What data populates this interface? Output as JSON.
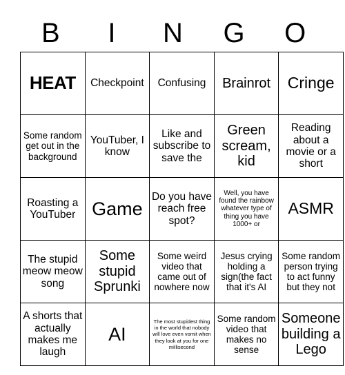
{
  "header": {
    "letters": [
      "B",
      "I",
      "N",
      "G",
      "O"
    ]
  },
  "grid": {
    "rows": [
      [
        {
          "text": "HEAT",
          "size": "bold-heat"
        },
        {
          "text": "Checkpoint",
          "size": "fs-md"
        },
        {
          "text": "Confusing",
          "size": "fs-md"
        },
        {
          "text": "Brainrot",
          "size": "fs-lg"
        },
        {
          "text": "Cringe",
          "size": "fs-xl"
        }
      ],
      [
        {
          "text": "Some random get out in the background",
          "size": "fs-sm"
        },
        {
          "text": "YouTuber, I know",
          "size": "fs-md"
        },
        {
          "text": "Like and subscribe to save the",
          "size": "fs-md"
        },
        {
          "text": "Green scream, kid",
          "size": "fs-lg"
        },
        {
          "text": "Reading about a movie or a short",
          "size": "fs-md"
        }
      ],
      [
        {
          "text": "Roasting a YouTuber",
          "size": "fs-md"
        },
        {
          "text": "Game",
          "size": "fs-xxl"
        },
        {
          "text": "Do you have reach free spot?",
          "size": "fs-md"
        },
        {
          "text": "Well, you have found the rainbow whatever type of thing you have 1000+ or",
          "size": "fs-xs"
        },
        {
          "text": "ASMR",
          "size": "fs-xl"
        }
      ],
      [
        {
          "text": "The stupid meow meow song",
          "size": "fs-md"
        },
        {
          "text": "Some stupid Sprunki",
          "size": "fs-lg"
        },
        {
          "text": "Some weird video that came out of nowhere now",
          "size": "fs-sm"
        },
        {
          "text": "Jesus crying holding a sign(the fact that it's AI",
          "size": "fs-sm"
        },
        {
          "text": "Some random person trying to act funny but they not",
          "size": "fs-sm"
        }
      ],
      [
        {
          "text": "A shorts that actually makes me laugh",
          "size": "fs-md"
        },
        {
          "text": "AI",
          "size": "fs-xxl"
        },
        {
          "text": "The most stupidest thing in the world that nobody will love even vomit when they look at you for one millisecond",
          "size": "fs-xxs"
        },
        {
          "text": "Some random video that makes no sense",
          "size": "fs-sm"
        },
        {
          "text": "Someone building a Lego",
          "size": "fs-lg"
        }
      ]
    ]
  }
}
